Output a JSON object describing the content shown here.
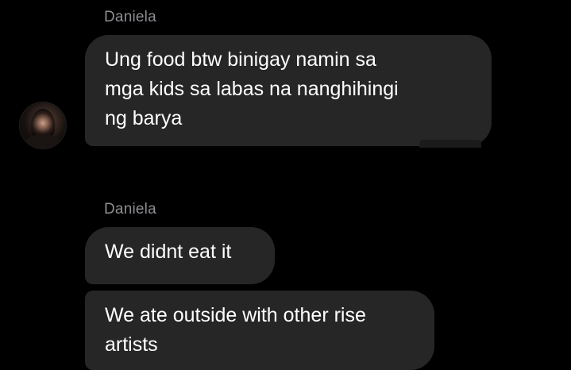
{
  "colors": {
    "background": "#000000",
    "bubble": "#262626",
    "sender_name": "#8e8e93",
    "message_text": "#ffffff"
  },
  "avatar": {
    "icon": "profile-photo"
  },
  "groups": [
    {
      "sender": "Daniela",
      "messages": [
        "Ung food btw binigay namin sa\nmga kids sa labas na nanghihingi\nng barya"
      ]
    },
    {
      "sender": "Daniela",
      "messages": [
        "We didnt eat it",
        "We ate outside with other rise\nartists"
      ]
    }
  ]
}
